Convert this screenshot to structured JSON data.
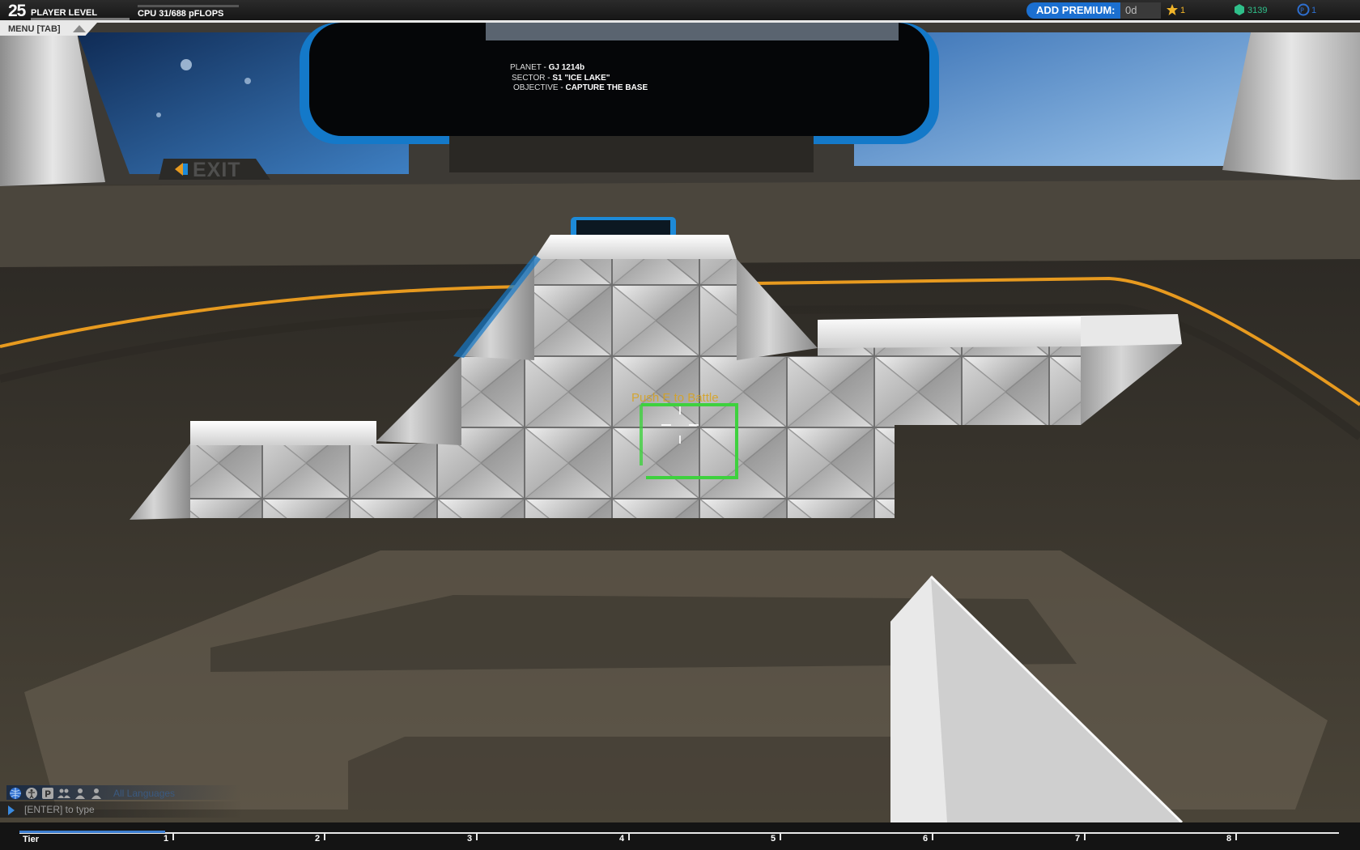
{
  "hud": {
    "player_level": "25",
    "player_level_label": "PLAYER LEVEL",
    "cpu_label": "CPU 31/688 pFLOPS",
    "add_premium_label": "ADD PREMIUM:",
    "premium_value": "0d",
    "stars_count": "1",
    "robits_count": "3139",
    "tech_points": "1",
    "colors": {
      "accent": "#1b6fd0",
      "robits": "#2fbf8a",
      "star": "#f0b429"
    }
  },
  "menu": {
    "label": "MENU [TAB]"
  },
  "mission": {
    "planet_key": "PLANET",
    "planet_value": "GJ 1214b",
    "sector_key": "SECTOR",
    "sector_value": "S1 \"ICE LAKE\"",
    "objective_key": "OBJECTIVE",
    "objective_value": "CAPTURE THE BASE"
  },
  "exit": {
    "label": "EXIT"
  },
  "crosshair": {
    "prompt": "Push E to Battle"
  },
  "chat": {
    "channel_label": "All Languages",
    "input_placeholder": "[ENTER] to type",
    "icons": [
      "globe-icon",
      "accessibility-icon",
      "party-icon",
      "clan-icon",
      "friends-icon",
      "person-icon"
    ]
  },
  "tiers": {
    "label": "Tier",
    "numbers": [
      "1",
      "2",
      "3",
      "4",
      "5",
      "6",
      "7",
      "8"
    ]
  }
}
